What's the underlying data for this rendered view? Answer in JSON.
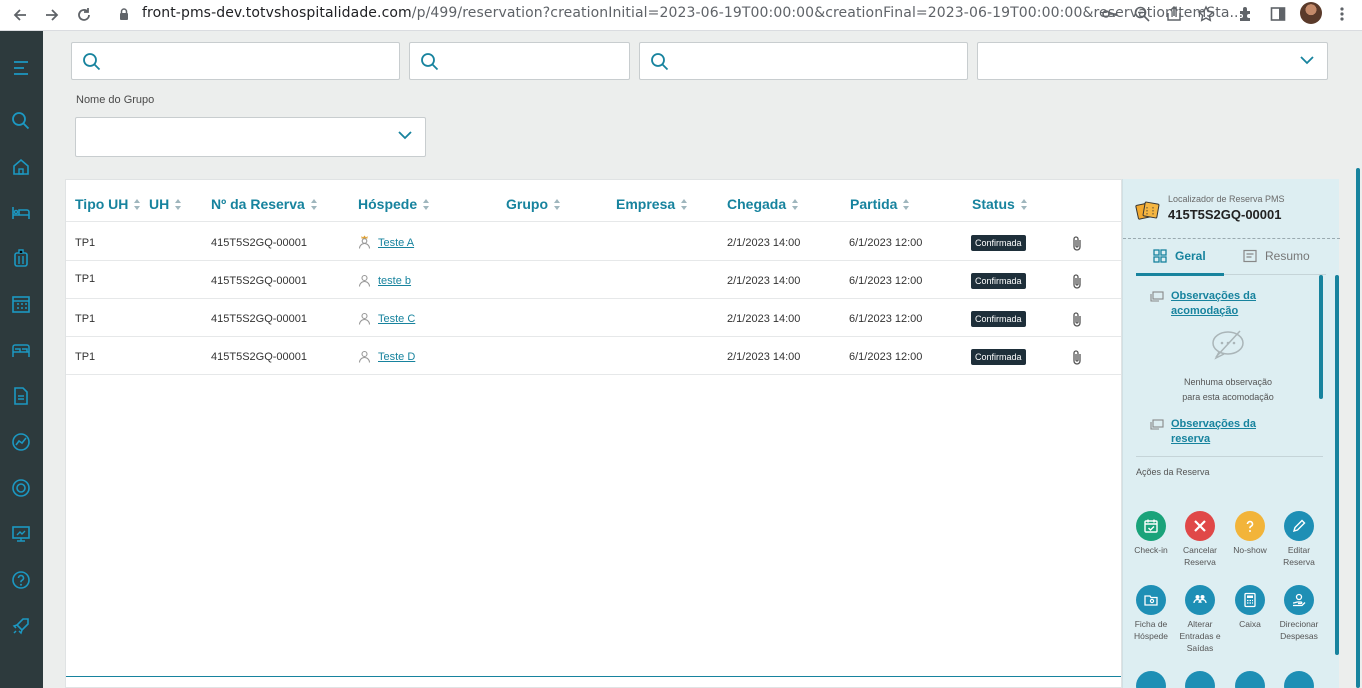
{
  "browser": {
    "url_host": "front-pms-dev.totvshospitalidade.com",
    "url_rest": "/p/499/reservation?creationInitial=2023-06-19T00:00:00&creationFinal=2023-06-19T00:00:00&reservationItemSta..."
  },
  "filters": {
    "grupo_label": "Nome do Grupo"
  },
  "table": {
    "headers": [
      "Tipo UH",
      "UH",
      "Nº da Reserva",
      "Hóspede",
      "Grupo",
      "Empresa",
      "Chegada",
      "Partida",
      "Status"
    ],
    "rows": [
      {
        "tipo": "TP1",
        "uh": "",
        "reserva": "415T5S2GQ-00001",
        "hospede": "Teste A",
        "grupo": "",
        "empresa": "",
        "chegada": "2/1/2023 14:00",
        "partida": "6/1/2023 12:00",
        "status": "Confirmada"
      },
      {
        "tipo": "TP1",
        "uh": "",
        "reserva": "415T5S2GQ-00001",
        "hospede": "teste b",
        "grupo": "",
        "empresa": "",
        "chegada": "2/1/2023 14:00",
        "partida": "6/1/2023 12:00",
        "status": "Confirmada"
      },
      {
        "tipo": "TP1",
        "uh": "",
        "reserva": "415T5S2GQ-00001",
        "hospede": "Teste C",
        "grupo": "",
        "empresa": "",
        "chegada": "2/1/2023 14:00",
        "partida": "6/1/2023 12:00",
        "status": "Confirmada"
      },
      {
        "tipo": "TP1",
        "uh": "",
        "reserva": "415T5S2GQ-00001",
        "hospede": "Teste D",
        "grupo": "",
        "empresa": "",
        "chegada": "2/1/2023 14:00",
        "partida": "6/1/2023 12:00",
        "status": "Confirmada"
      }
    ]
  },
  "panel": {
    "localizador_label": "Localizador de Reserva PMS",
    "localizador_num": "415T5S2GQ-00001",
    "tab_geral": "Geral",
    "tab_resumo": "Resumo",
    "obs_acomodacao": "Observações da acomodação",
    "empty_line1": "Nenhuma observação",
    "empty_line2": "para esta acomodação",
    "obs_reserva": "Observações da reserva",
    "acoes_label": "Ações da Reserva",
    "actions": [
      {
        "label": "Check-in",
        "color": "#1aa37a",
        "icon": "calendar-check-icon"
      },
      {
        "label": "Cancelar Reserva",
        "color": "#e04848",
        "icon": "close-icon"
      },
      {
        "label": "No-show",
        "color": "#f2b43a",
        "icon": "question-icon"
      },
      {
        "label": "Editar Reserva",
        "color": "#1e8fb5",
        "icon": "pencil-icon"
      },
      {
        "label": "Ficha de Hóspede",
        "color": "#1e8fb5",
        "icon": "guest-card-icon"
      },
      {
        "label": "Alterar Entradas e Saídas",
        "color": "#1e8fb5",
        "icon": "people-icon"
      },
      {
        "label": "Caixa",
        "color": "#1e8fb5",
        "icon": "calculator-icon"
      },
      {
        "label": "Direcionar Despesas",
        "color": "#1e8fb5",
        "icon": "hand-coin-icon"
      }
    ]
  },
  "colors": {
    "accent": "#17839e",
    "sidebar": "#2d3a3d",
    "badge": "#1e2f3a"
  }
}
